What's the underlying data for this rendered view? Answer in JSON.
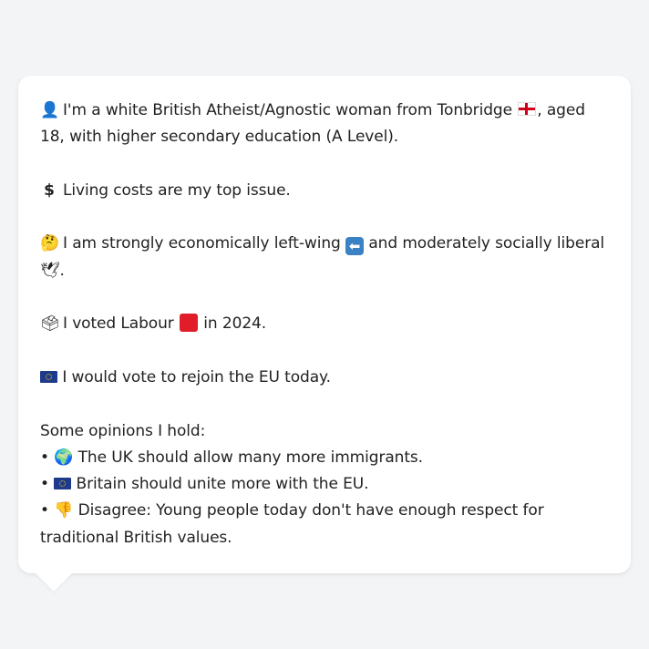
{
  "profile": {
    "intro_a": "I'm a white British Atheist/Agnostic woman from Tonbridge",
    "intro_b": ", aged 18,",
    "intro_c": "with higher secondary education (A Level).",
    "issue": "Living costs are my top issue.",
    "stance_a": "I am strongly economically left-wing",
    "stance_b": "and moderately socially liberal",
    "stance_c": ".",
    "vote_a": "I voted Labour",
    "vote_b": "in 2024.",
    "eu": "I would vote to rejoin the EU today.",
    "opinions_heading": "Some opinions I hold:",
    "opinions": [
      "The UK should allow many more immigrants.",
      "Britain should unite more with the EU.",
      "Disagree: Young people today don't have enough respect for traditional British values."
    ]
  },
  "icons": {
    "person": "bust-in-silhouette-icon",
    "dollar": "heavy-dollar-sign-icon",
    "thinking": "thinking-face-icon",
    "ballot": "ballot-box-icon",
    "eu_flag": "eu-flag-icon",
    "globe": "globe-icon",
    "thumbs_down": "thumbs-down-icon",
    "dove": "dove-icon",
    "left_arrow": "left-arrow-icon",
    "england_flag": "england-flag-icon",
    "red_square": "red-square-icon"
  },
  "colors": {
    "background": "#f3f4f6",
    "card": "#ffffff",
    "text": "#222222",
    "labour_red": "#e11d2a",
    "eu_blue": "#1e3a8a"
  }
}
